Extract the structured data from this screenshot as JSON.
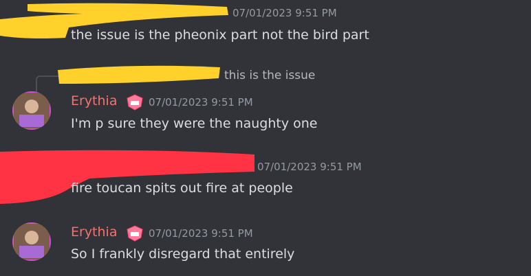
{
  "colors": {
    "background": "#313338",
    "username": "#f87171",
    "timestamp": "#949ba4",
    "message_text": "#dbdee1",
    "redaction_yellow": "#ffd12a",
    "redaction_red": "#ff3343"
  },
  "messages": [
    {
      "timestamp": "07/01/2023 9:51 PM",
      "text": "the issue is the pheonix part not the bird part"
    },
    {
      "reply_preview": "this is the issue",
      "username": "Erythia",
      "timestamp": "07/01/2023 9:51 PM",
      "text": "I'm p sure they were the naughty one",
      "badge_icon": "guild-badge-icon"
    },
    {
      "timestamp": "07/01/2023 9:51 PM",
      "text": "fire toucan spits out fire at people"
    },
    {
      "username": "Erythia",
      "timestamp": "07/01/2023 9:51 PM",
      "text": "So I frankly disregard that entirely",
      "badge_icon": "guild-badge-icon"
    }
  ]
}
